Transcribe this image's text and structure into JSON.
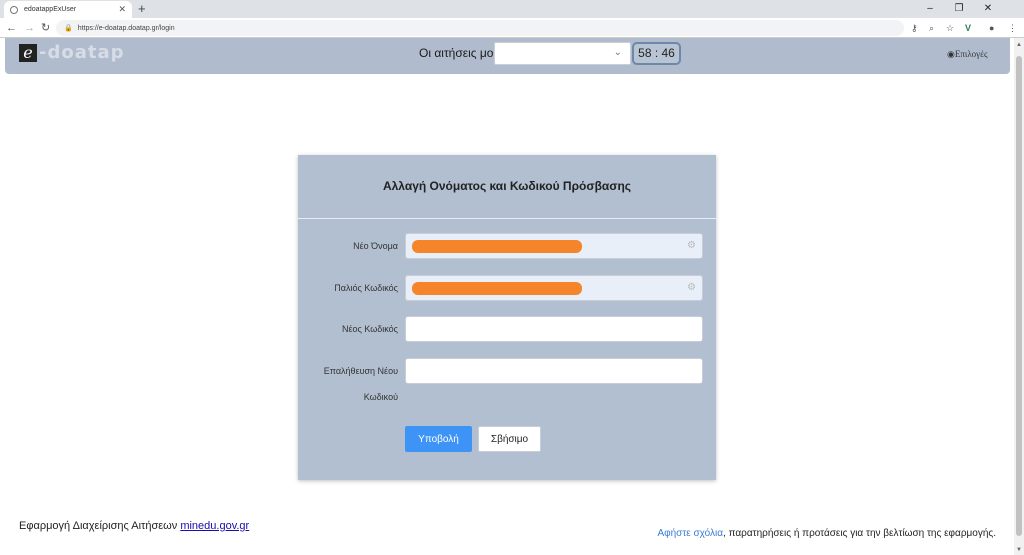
{
  "browser": {
    "tab_title": "edoatappExUser",
    "url": "https://e-doatap.doatap.gr/login",
    "new_tab": "+",
    "minimize": "–",
    "restore": "❐",
    "close": "✕"
  },
  "header": {
    "logo_e": "e",
    "logo_text": "-doatap",
    "applications_label": "Οι αιτήσεις μου",
    "applications_selected": "",
    "timer": "58 : 46",
    "options_label": "Επιλογές"
  },
  "form": {
    "title": "Αλλαγή Ονόματος και Κωδικού Πρόσβασης",
    "fields": [
      {
        "label": "Νέο Όνομα",
        "value": "",
        "redacted": true
      },
      {
        "label": "Παλιός Κωδικός",
        "value": "",
        "redacted": true
      },
      {
        "label": "Νέος Κωδικός",
        "value": "",
        "redacted": false
      },
      {
        "label_line1": "Επαλήθευση Νέου",
        "label_line2": "Κωδικού",
        "value": "",
        "redacted": false
      }
    ],
    "submit_label": "Υποβολή",
    "clear_label": "Σβήσιμο"
  },
  "footer": {
    "left_text": "Εφαρμογή Διαχείρισης Αιτήσεων ",
    "left_link": "minedu.gov.gr",
    "right_link": "Αφήστε σχόλια",
    "right_text": ", παρατηρήσεις ή προτάσεις για την βελτίωση της εφαρμογής."
  },
  "colors": {
    "header_bg": "#b0bccd",
    "card_bg": "#b1bfd1",
    "submit_bg": "#3d94f6",
    "redaction": "#f5842a"
  }
}
